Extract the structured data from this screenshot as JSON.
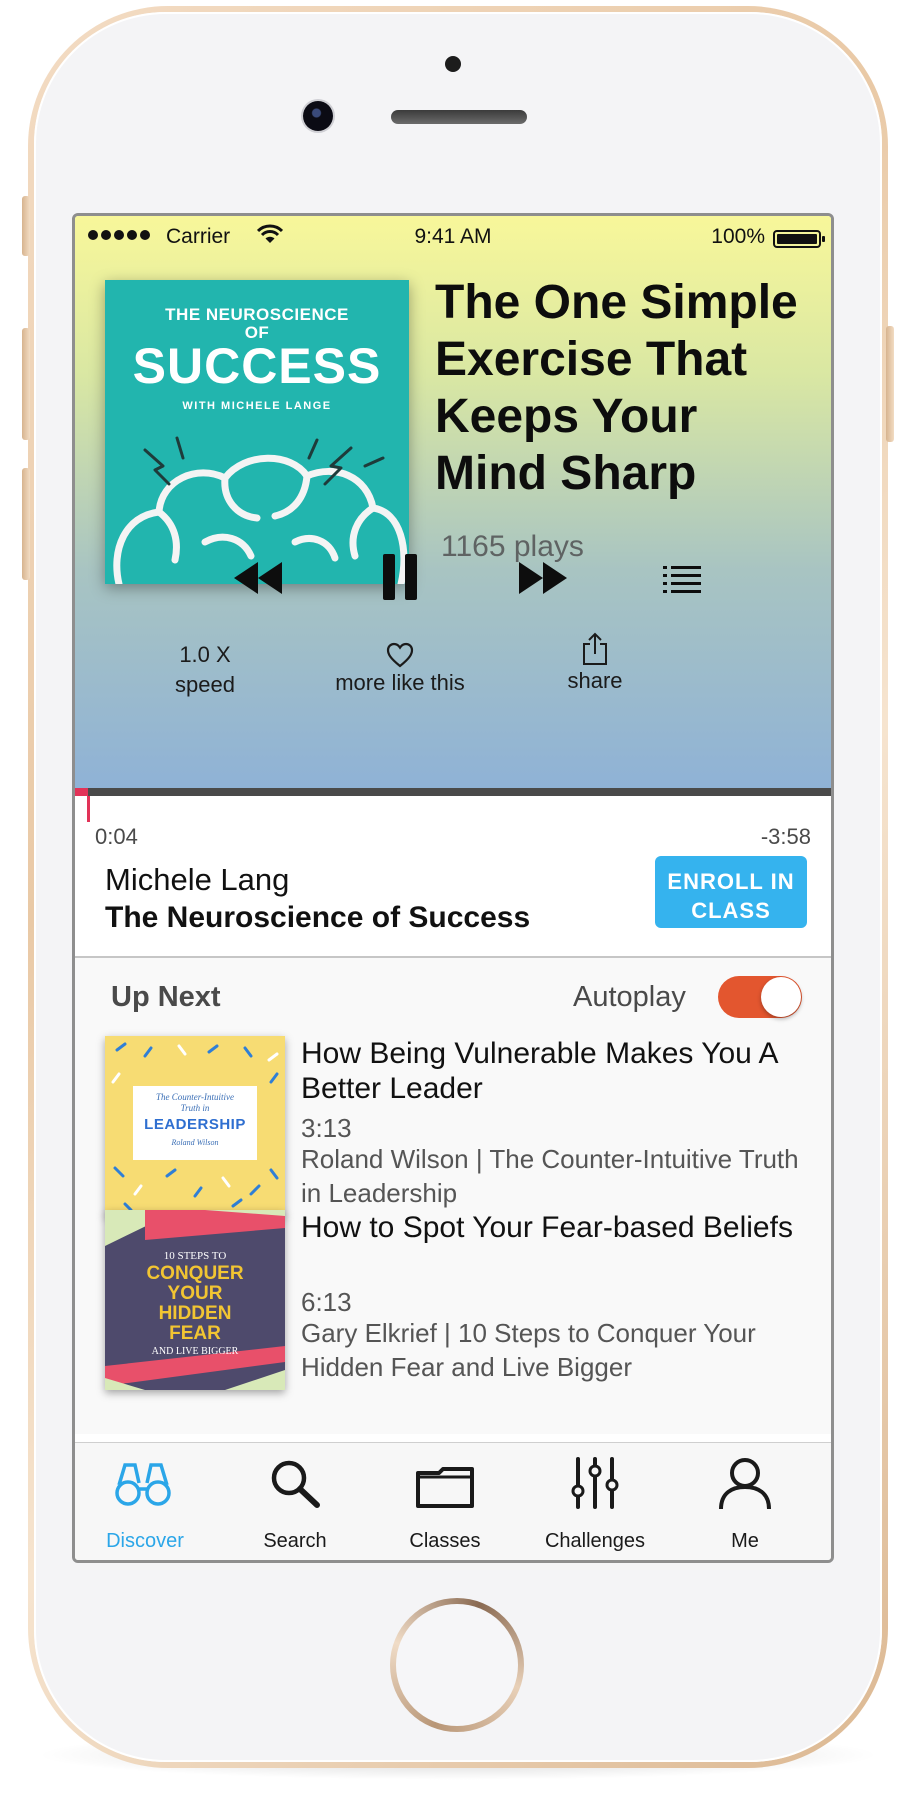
{
  "status_bar": {
    "carrier": "Carrier",
    "time": "9:41 AM",
    "battery": "100%"
  },
  "now_playing": {
    "cover": {
      "kicker_line1": "THE NEUROSCIENCE",
      "kicker_line2": "OF",
      "title": "SUCCESS",
      "byline": "WITH MICHELE LANGE",
      "bg_color": "#22b5ae"
    },
    "title": "The One Simple Exercise That Keeps Your Mind Sharp",
    "plays": "1165 plays",
    "speed_value": "1.0 X",
    "speed_label": "speed",
    "more_like_this": "more like this",
    "share": "share",
    "elapsed": "0:04",
    "remaining": "-3:58",
    "author": "Michele Lang",
    "course": "The Neuroscience of Success",
    "enroll_label": "ENROLL IN CLASS",
    "progress_fraction": 0.017,
    "accent_color": "#35b3ee"
  },
  "up_next": {
    "heading": "Up Next",
    "autoplay_label": "Autoplay",
    "autoplay_on": true,
    "items": [
      {
        "title": "How Being Vulnerable Makes You A Better Leader",
        "duration": "3:13",
        "subtitle": "Roland Wilson | The Counter-Intuitive Truth in Leadership",
        "cover": {
          "line1": "The Counter-Intuitive",
          "line2": "Truth in",
          "title": "LEADERSHIP",
          "author": "Roland Wilson"
        }
      },
      {
        "title": "How to Spot Your Fear-based Beliefs",
        "duration": "6:13",
        "subtitle": "Gary Elkrief | 10 Steps to Conquer Your Hidden Fear and Live Bigger",
        "cover": {
          "line1": "10 STEPS TO",
          "title_1": "CONQUER",
          "title_2": "YOUR",
          "title_3": "HIDDEN",
          "title_4": "FEAR",
          "line2": "AND LIVE BIGGER"
        }
      }
    ]
  },
  "tabs": [
    {
      "label": "Discover",
      "icon": "binoculars-icon",
      "active": true
    },
    {
      "label": "Search",
      "icon": "search-icon",
      "active": false
    },
    {
      "label": "Classes",
      "icon": "folder-icon",
      "active": false
    },
    {
      "label": "Challenges",
      "icon": "sliders-icon",
      "active": false
    },
    {
      "label": "Me",
      "icon": "person-icon",
      "active": false
    }
  ]
}
